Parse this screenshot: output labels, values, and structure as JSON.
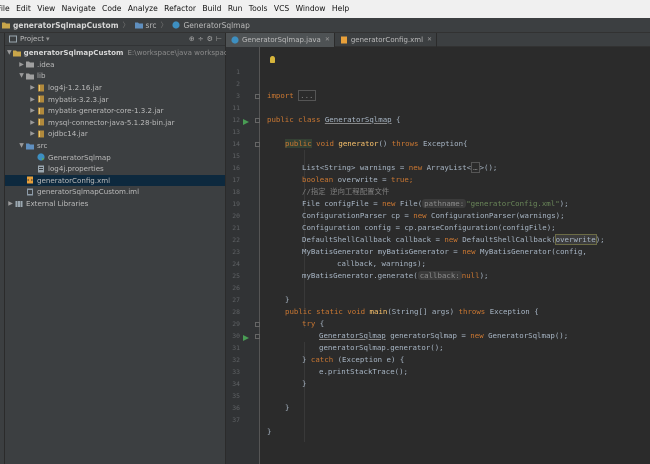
{
  "menu": [
    "File",
    "Edit",
    "View",
    "Navigate",
    "Code",
    "Analyze",
    "Refactor",
    "Build",
    "Run",
    "Tools",
    "VCS",
    "Window",
    "Help"
  ],
  "navbar": {
    "crumbs": [
      "generatorSqlmapCustom",
      "src",
      "GeneratorSqlmap"
    ]
  },
  "project_panel": {
    "title": "Project",
    "root": "generatorSqlmapCustom",
    "root_path": "E:\\workspace\\java workspace\\java",
    "items": {
      "idea": ".idea",
      "lib": "lib",
      "jar1": "log4j-1.2.16.jar",
      "jar2": "mybatis-3.2.3.jar",
      "jar3": "mybatis-generator-core-1.3.2.jar",
      "jar4": "mysql-connector-java-5.1.28-bin.jar",
      "jar5": "ojdbc14.jar",
      "src": "src",
      "cls": "GeneratorSqlmap",
      "props": "log4j.properties",
      "xml": "generatorConfig.xml",
      "iml": "generatorSqlmapCustom.iml",
      "ext": "External Libraries"
    }
  },
  "tabs": [
    "GeneratorSqlmap.java",
    "generatorConfig.xml"
  ],
  "line_numbers": [
    "1",
    "2",
    "3",
    "11",
    "12",
    "13",
    "14",
    "15",
    "16",
    "17",
    "18",
    "19",
    "20",
    "21",
    "22",
    "23",
    "24",
    "25",
    "26",
    "27",
    "28",
    "29",
    "30",
    "31",
    "32",
    "33",
    "34",
    "35",
    "36",
    "37"
  ],
  "code": {
    "l3_kw": "import",
    "l3_fold": "...",
    "l12_kw": "public class",
    "l12_name": "GeneratorSqlmap",
    "l12_end": " {",
    "l14_pub": "public",
    "l14_void": " void ",
    "l14_fn": "generator",
    "l14_mid": "()",
    "l14_throws": " throws ",
    "l14_ex": "Exception{",
    "l16_a": "List<String> warnings = ",
    "l16_new": "new",
    "l16_b": " ArrayList<",
    "l16_fold": "…",
    "l16_c": ">();",
    "l17_kw": "boolean",
    "l17_a": " overwrite = ",
    "l17_true": "true",
    "l17_b": ";",
    "l18_comment": "//指定 逆向工程配置文件",
    "l19_a": "File configFile = ",
    "l19_new": "new",
    "l19_b": " File(",
    "l19_hint": "pathname:",
    "l19_str": "\"generatorConfig.xml\"",
    "l19_c": ");",
    "l20_a": "ConfigurationParser cp = ",
    "l20_new": "new",
    "l20_b": " ConfigurationParser(warnings);",
    "l21": "Configuration config = cp.parseConfiguration(configFile);",
    "l22_a": "DefaultShellCallback callback = ",
    "l22_new": "new",
    "l22_b": " DefaultShellCallback(",
    "l22_hl": "overwrite",
    "l22_c": ");",
    "l23_a": "MyBatisGenerator myBatisGenerator = ",
    "l23_new": "new",
    "l23_b": " MyBatisGenerator(config,",
    "l24": "callback, warnings);",
    "l25_a": "myBatisGenerator.generate(",
    "l25_hint": "callback:",
    "l25_null": "null",
    "l25_b": ");",
    "l27": "}",
    "l28_kw": "public static void",
    "l28_fn": " main",
    "l28_a": "(String[] args) ",
    "l28_throws": "throws",
    "l28_b": " Exception {",
    "l29_kw": "try",
    "l29_b": " {",
    "l30_a": "GeneratorSqlmap",
    "l30_b": " generatorSqlmap = ",
    "l30_new": "new",
    "l30_c": " GeneratorSqlmap();",
    "l31": "generatorSqlmap.generator();",
    "l32_a": "} ",
    "l32_kw": "catch",
    "l32_b": " (Exception e) {",
    "l33": "e.printStackTrace();",
    "l34": "}",
    "l36": "}",
    "l37": "}"
  },
  "colors": {
    "keyword": "#cc7832",
    "method": "#ffc66d",
    "string": "#6a8759",
    "comment": "#808080",
    "text": "#a9b7c6",
    "panel": "#3c3f41",
    "editor": "#2b2b2b"
  }
}
